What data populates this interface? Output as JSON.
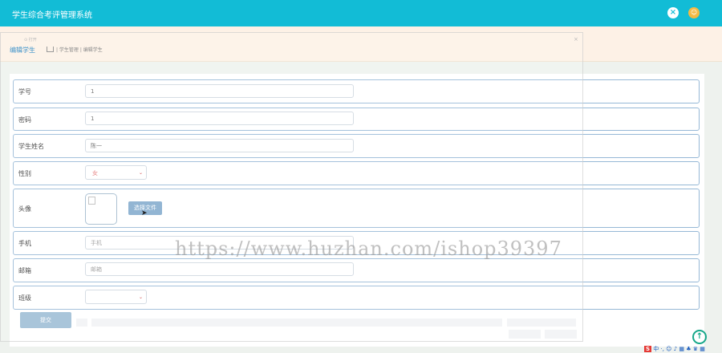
{
  "header": {
    "title": "学生综合考评管理系统",
    "close_icon": "×",
    "avatar_icon": "☺"
  },
  "breadcrumb": {
    "page_title": "编辑学生",
    "path": "| 学生管理 | 编辑学生"
  },
  "dialog": {
    "caption": "⊙ 打开",
    "close": "×"
  },
  "form": {
    "fields": [
      {
        "label": "学号",
        "value": "1"
      },
      {
        "label": "密码",
        "value": "1"
      },
      {
        "label": "学生姓名",
        "value": "陈一"
      },
      {
        "label": "性别",
        "value": "女"
      },
      {
        "label": "头像",
        "button": "选择文件"
      },
      {
        "label": "手机",
        "placeholder": "手机"
      },
      {
        "label": "邮箱",
        "placeholder": "邮箱"
      },
      {
        "label": "班级",
        "value": ""
      }
    ],
    "submit": "提交"
  },
  "watermark": "https://www.huzhan.com/ishop39397",
  "to_top_icon": "↑",
  "ime": {
    "logo": "S",
    "text": "中 ·, ☺ ♪ ▦ ♣ ♛ ▦"
  },
  "colors": {
    "header": "#12bcd6",
    "accent": "#1a7fc0",
    "button": "#7fa9cc"
  }
}
